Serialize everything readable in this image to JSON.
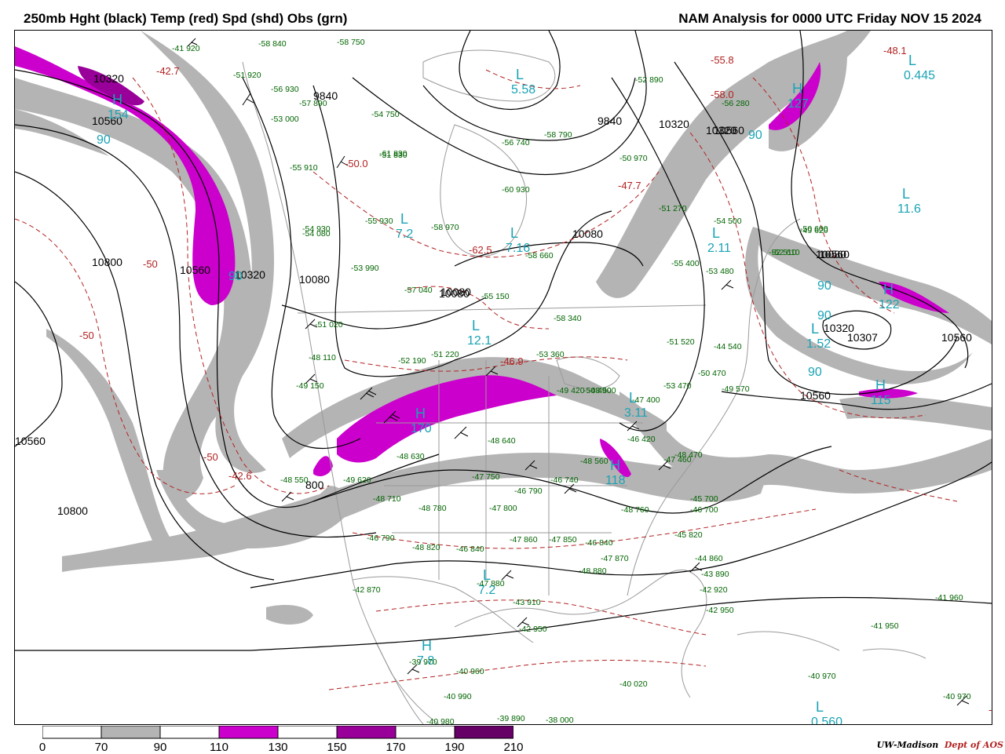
{
  "header": {
    "left_title": "250mb Hght (black) Temp (red) Spd (shd) Obs (grn)",
    "right_title": "NAM Analysis for 0000 UTC Friday  NOV 15 2024"
  },
  "legend": {
    "ticks": [
      "0",
      "70",
      "90",
      "110",
      "130",
      "150",
      "170",
      "190",
      "210"
    ],
    "colors": [
      "#ffffff",
      "#b4b4b4",
      "#ffffff",
      "#cc00cc",
      "#ffffff",
      "#990099",
      "#ffffff",
      "#660066"
    ]
  },
  "credit": {
    "org": "UW-Madison",
    "dept": "Dept of AOS"
  },
  "colors": {
    "height": "#000000",
    "temp": "#b22222",
    "speed_70": "#b4b4b4",
    "speed_110": "#cc00cc",
    "speed_150": "#990099",
    "obs": "#006400",
    "centers": "#1aa3b5",
    "coast": "#9a9a9a"
  },
  "height_labels": [
    "10320",
    "10560",
    "10800",
    "10560",
    "10320",
    "10080",
    "9840",
    "9840",
    "10080",
    "10320",
    "10560",
    "10080",
    "10080",
    "10080",
    "10320",
    "10307",
    "10560",
    "10560",
    "10560",
    "10800",
    "800",
    "10560",
    "10320"
  ],
  "temp_labels": [
    "-50",
    "-50",
    "-50",
    "-50",
    "-42.7",
    "-50.0",
    "-62.5",
    "-46.9",
    "-47.7",
    "-58.0",
    "-55.8",
    "-48.1",
    "-42.6"
  ],
  "centers": [
    {
      "letter": "H",
      "value": "154",
      "kind": "H"
    },
    {
      "letter": "L",
      "value": "7.2",
      "kind": "L"
    },
    {
      "letter": "L",
      "value": "7.16",
      "kind": "L"
    },
    {
      "letter": "L",
      "value": "12.1",
      "kind": "L"
    },
    {
      "letter": "H",
      "value": "170",
      "kind": "H"
    },
    {
      "letter": "H",
      "value": "118",
      "kind": "H"
    },
    {
      "letter": "L",
      "value": "2.11",
      "kind": "L"
    },
    {
      "letter": "L",
      "value": "3.11",
      "kind": "L"
    },
    {
      "letter": "L",
      "value": "1.52",
      "kind": "L"
    },
    {
      "letter": "H",
      "value": "122",
      "kind": "H"
    },
    {
      "letter": "H",
      "value": "115",
      "kind": "H"
    },
    {
      "letter": "H",
      "value": "127",
      "kind": "H"
    },
    {
      "letter": "L",
      "value": "11.6",
      "kind": "L"
    },
    {
      "letter": "L",
      "value": "0.445",
      "kind": "L"
    },
    {
      "letter": "L",
      "value": "7.2",
      "kind": "L"
    },
    {
      "letter": "H",
      "value": "7.8",
      "kind": "H"
    },
    {
      "letter": "L",
      "value": "0.560",
      "kind": "L"
    },
    {
      "letter": "L",
      "value": "5.58",
      "kind": "L"
    }
  ],
  "speed_labels": [
    "90",
    "90",
    "90",
    "90",
    "90",
    "90"
  ],
  "obs": [
    "-41 920",
    "-58 840",
    "-58 750",
    "-51 920",
    "-56 930",
    "-57 890",
    "-55 910",
    "-53 000",
    "-54 750",
    "-51 830",
    "-55 930",
    "-61 830",
    "-54 930",
    "-58 970",
    "-60 930",
    "-53 990",
    "-57 040",
    "-55 150",
    "-58 340",
    "-51 520",
    "-53 480",
    "-52 510",
    "-54 500",
    "-55 400",
    "-51 270",
    "-50 970",
    "-58 790",
    "-56 740",
    "-52 890",
    "-56 280",
    "-49 620",
    "-54 080",
    "-51 020",
    "-48 110",
    "-49 150",
    "-52 190",
    "-51 220",
    "-53 360",
    "-49 420",
    "-50 490",
    "-48 500",
    "-47 400",
    "-46 420",
    "-48 560",
    "-48 640",
    "-48 630",
    "-49 620",
    "-48 550",
    "-47 800",
    "-48 780",
    "-46 790",
    "-48 820",
    "-46 840",
    "-47 860",
    "-47 850",
    "-46 840",
    "-47 750",
    "-46 740",
    "-48 760",
    "-46 790",
    "-48 880",
    "-47 870",
    "-45 820",
    "-44 860",
    "-43 890",
    "-42 920",
    "-42 950",
    "-43 910",
    "-42 870",
    "-47 880",
    "-42 950",
    "-39 970",
    "-40 960",
    "-40 990",
    "-40 980",
    "-39 890",
    "-38 000",
    "-40 020",
    "-40 970",
    "-41 950",
    "-41 960",
    "-40 970",
    "-50 600",
    "-52 610",
    "-45 700",
    "-48 470",
    "-47 460",
    "-53 470",
    "-50 470",
    "-44 540",
    "-49 570",
    "-58 660",
    "-46 700",
    "-48 710"
  ]
}
